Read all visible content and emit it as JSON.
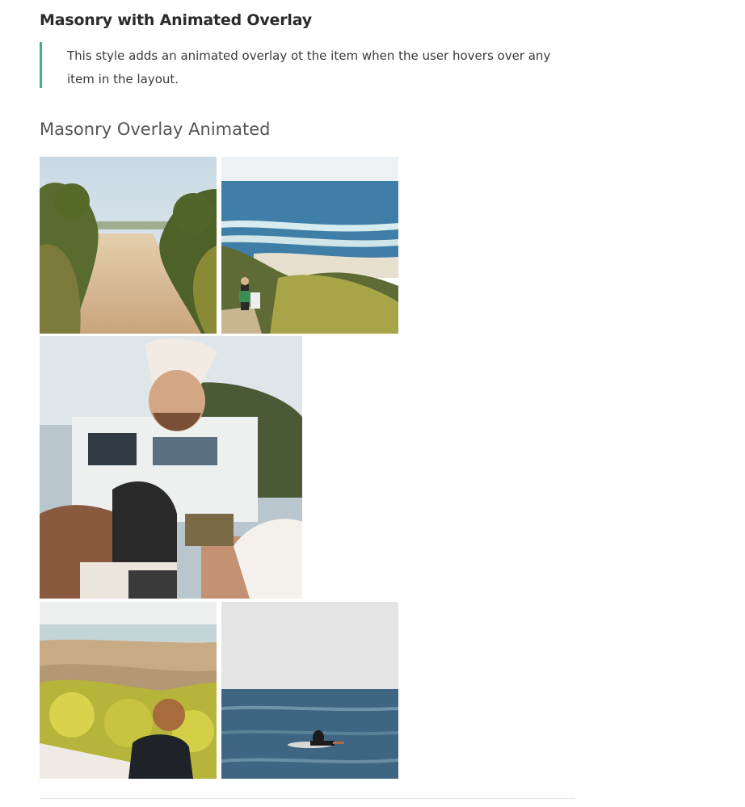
{
  "section": {
    "title": "Masonry with Animated Overlay",
    "description": "This style adds an animated overlay ot the item when the user hovers over any item in the layout."
  },
  "gallery": {
    "heading": "Masonry Overlay Animated",
    "accent_color": "#3fb38b"
  }
}
